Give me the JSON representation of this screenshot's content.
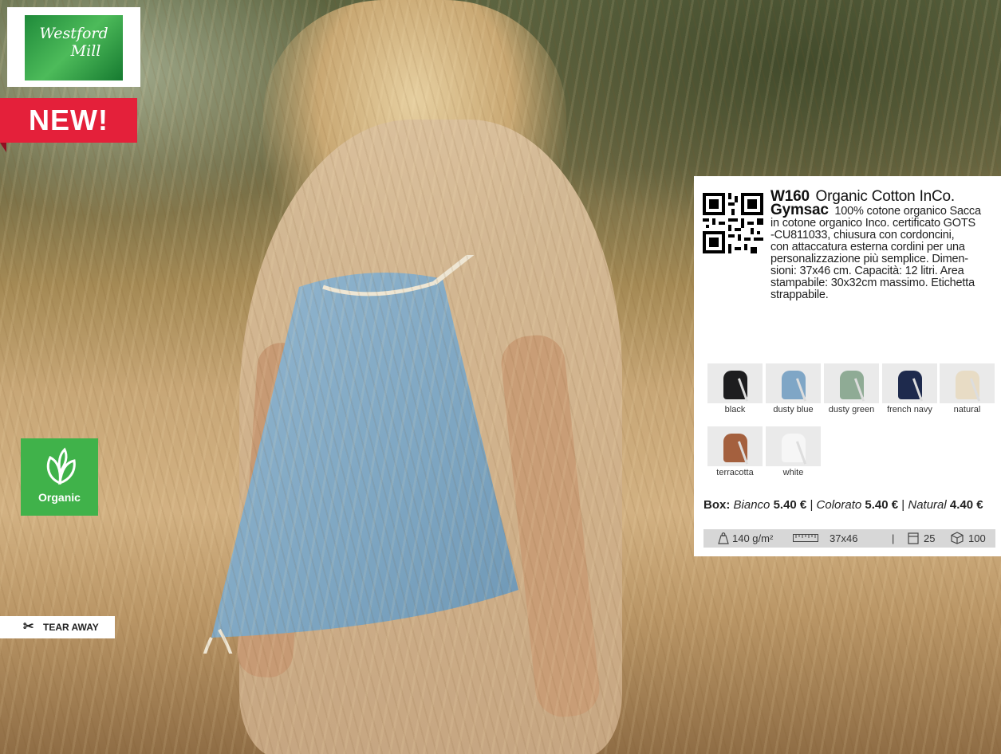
{
  "brand": {
    "logo_line1": "Westford",
    "logo_line2": "Mill"
  },
  "badges": {
    "new": "NEW!",
    "organic": "Organic",
    "tear_away": "TEAR AWAY",
    "scissors": "✂"
  },
  "product": {
    "code": "W160",
    "name_line1": "Organic Cotton InCo.",
    "name_line2": "Gymsac",
    "desc_l1": "100% cotone organico  Sacca",
    "desc_l2": "in cotone organico Inco. certificato GOTS",
    "desc_l3": "-CU811033, chiusura con cordoncini,",
    "desc_l4": "con attaccatura esterna cordini per una",
    "desc_l5": "personalizzazione più semplice. Dimen-",
    "desc_l6": "sioni: 37x46 cm. Capacità: 12 litri. Area",
    "desc_l7": "stampabile: 30x32cm massimo. Etichetta",
    "desc_l8": "strappabile."
  },
  "colors": [
    {
      "label": "black",
      "hex": "#1d1d1f"
    },
    {
      "label": "dusty blue",
      "hex": "#7fa6c6"
    },
    {
      "label": "dusty green",
      "hex": "#8fab95"
    },
    {
      "label": "french navy",
      "hex": "#1e2a4d"
    },
    {
      "label": "natural",
      "hex": "#e8dcc5"
    },
    {
      "label": "terracotta",
      "hex": "#a4603e"
    },
    {
      "label": "white",
      "hex": "#f6f6f6"
    }
  ],
  "prices": {
    "box_label": "Box:",
    "bianco_label": "Bianco",
    "bianco_value": "5.40 €",
    "colorato_label": "Colorato",
    "colorato_value": "5.40 €",
    "natural_label": "Natural",
    "natural_value": "4.40 €",
    "sep": "|"
  },
  "specs": {
    "weight": "140 g/m²",
    "size": "37x46",
    "sep": "|",
    "pack": "25",
    "carton": "100"
  }
}
